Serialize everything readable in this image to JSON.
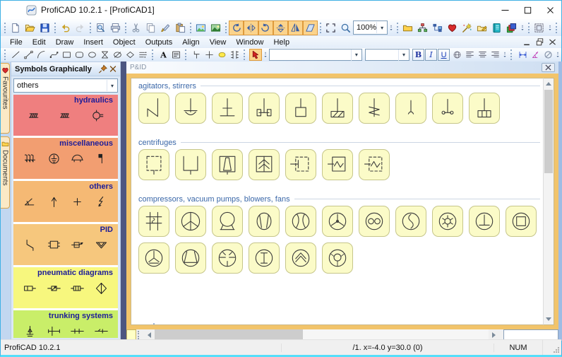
{
  "window": {
    "title": "ProfiCAD 10.2.1 - [ProfiCAD1]"
  },
  "menu": {
    "items": [
      "File",
      "Edit",
      "Draw",
      "Insert",
      "Object",
      "Outputs",
      "Align",
      "View",
      "Window",
      "Help"
    ]
  },
  "toolbar1": {
    "zoom_value": "100%",
    "file": [
      {
        "name": "new-button",
        "icon": "new"
      },
      {
        "name": "open-button",
        "icon": "open"
      },
      {
        "name": "save-button",
        "icon": "save"
      }
    ],
    "undo": [
      {
        "name": "undo-button",
        "icon": "undo"
      },
      {
        "name": "redo-button",
        "icon": "redo",
        "cls": "dis"
      }
    ],
    "print": [
      {
        "name": "print-preview-button",
        "icon": "preview"
      },
      {
        "name": "print-button",
        "icon": "print"
      }
    ],
    "clipboard": [
      {
        "name": "cut-button",
        "icon": "cut"
      },
      {
        "name": "copy-button",
        "icon": "copy"
      },
      {
        "name": "format-painter-button",
        "icon": "paint"
      },
      {
        "name": "paste-button",
        "icon": "paste"
      }
    ],
    "images": [
      {
        "name": "export-image-button",
        "icon": "image"
      },
      {
        "name": "insert-image-button",
        "icon": "image2"
      }
    ],
    "transform": [
      {
        "name": "rotate-left-button",
        "icon": "rot-l",
        "cls": "orange"
      },
      {
        "name": "flip-horizontal-button",
        "icon": "flip-h",
        "cls": "orange"
      },
      {
        "name": "rotate-right-button",
        "icon": "rot-r",
        "cls": "orange"
      },
      {
        "name": "flip-vertical-button",
        "icon": "flip-v",
        "cls": "orange"
      },
      {
        "name": "mirror-button",
        "icon": "mirror",
        "cls": "orange"
      },
      {
        "name": "shear-button",
        "icon": "shear",
        "cls": "orange"
      }
    ],
    "view": [
      {
        "name": "select-region-button",
        "icon": "sel-region"
      },
      {
        "name": "zoom-button",
        "icon": "lens"
      }
    ],
    "panels": [
      {
        "name": "symbols-folder-button",
        "icon": "folder"
      },
      {
        "name": "hierarchy-button",
        "icon": "hierarchy"
      },
      {
        "name": "share-button",
        "icon": "share"
      },
      {
        "name": "favourites-button",
        "icon": "heart"
      },
      {
        "name": "magic-wand-button",
        "icon": "wand"
      },
      {
        "name": "edit-symbol-button",
        "icon": "sym-edit"
      },
      {
        "name": "notebook-button",
        "icon": "notebook"
      },
      {
        "name": "layers-button",
        "icon": "layers"
      }
    ],
    "grouping": [
      {
        "name": "group-objects-button",
        "icon": "group-objects"
      }
    ],
    "align": [
      {
        "name": "align-left-button",
        "icon": "al-left"
      },
      {
        "name": "align-center-button",
        "icon": "al-center"
      },
      {
        "name": "align-right-button",
        "icon": "al-right"
      },
      {
        "name": "align-top-button",
        "icon": "al-top"
      },
      {
        "name": "align-middle-button",
        "icon": "al-middle"
      },
      {
        "name": "align-bottom-button",
        "icon": "al-bottom"
      }
    ]
  },
  "toolbar2": {
    "draw": [
      {
        "name": "line-tool",
        "icon": "line"
      },
      {
        "name": "polyline-tool",
        "icon": "polyline"
      },
      {
        "name": "arc-tool",
        "icon": "arc"
      },
      {
        "name": "bezier-tool",
        "icon": "bezier"
      },
      {
        "name": "rectangle-tool",
        "icon": "rect"
      },
      {
        "name": "rounded-rectangle-tool",
        "icon": "round-rect"
      },
      {
        "name": "ellipse-tool",
        "icon": "ellipse"
      },
      {
        "name": "hourglass-tool",
        "icon": "hourglass"
      },
      {
        "name": "crossed-ellipse-tool",
        "icon": "ellipse-slash"
      },
      {
        "name": "label-tool",
        "icon": "diamond"
      },
      {
        "name": "line-style-tool",
        "icon": "line-style"
      }
    ],
    "text": [
      {
        "name": "text-tool",
        "icon": "text"
      },
      {
        "name": "textbox-tool",
        "icon": "textbox"
      }
    ],
    "place": [
      {
        "name": "gate-tool",
        "icon": "gate"
      },
      {
        "name": "junction-tool",
        "icon": "junction"
      },
      {
        "name": "node-tool",
        "icon": "node"
      },
      {
        "name": "ic-pins-tool",
        "icon": "ic-pins"
      }
    ],
    "pointer": [
      {
        "name": "pointer-tool",
        "icon": "pointer",
        "cls": "orange"
      }
    ],
    "font_family_value": "",
    "font_size_value": "",
    "format": [
      {
        "name": "bold-button",
        "label": "B",
        "cls": "fb"
      },
      {
        "name": "italic-button",
        "label": "I",
        "cls": "fi"
      },
      {
        "name": "underline-button",
        "label": "U",
        "cls": "fu"
      }
    ],
    "link": [
      {
        "name": "hyperlink-button",
        "icon": "globe"
      }
    ],
    "text_align": [
      {
        "name": "text-align-left-button",
        "icon": "txt-left"
      },
      {
        "name": "text-align-center-button",
        "icon": "txt-center"
      },
      {
        "name": "text-align-right-button",
        "icon": "txt-right"
      }
    ],
    "dimension": [
      {
        "name": "linear-dimension-button",
        "icon": "dim-linear"
      },
      {
        "name": "angle-dimension-button",
        "icon": "dim-angle"
      },
      {
        "name": "no-dimension-button",
        "icon": "dim-off"
      }
    ]
  },
  "sidebar": {
    "header": "Symbols Graphically",
    "dropdown_value": "others",
    "tabs": [
      {
        "label": "Favourites",
        "icon": "heart"
      },
      {
        "label": "Documents",
        "icon": "folder"
      }
    ],
    "sections": [
      {
        "title": "hydraulics",
        "color": "#ef7f7f",
        "symbols": [
          "hy-hatch",
          "hy-hatch",
          "hy-gauge"
        ]
      },
      {
        "title": "miscellaneous",
        "color": "#f29e71",
        "symbols": [
          "mi-pins",
          "mi-earth",
          "mi-dome",
          "mi-flag"
        ]
      },
      {
        "title": "others",
        "color": "#f5b974",
        "symbols": [
          "ot-angle",
          "ot-arrow",
          "ot-plus",
          "ot-bolt"
        ]
      },
      {
        "title": "PID",
        "color": "#f6c77d",
        "symbols": [
          "pd-slope",
          "pd-vessel",
          "pd-valve",
          "pd-funnel"
        ]
      },
      {
        "title": "pneumatic diagrams",
        "color": "#f7f77e",
        "symbols": [
          "pn-cyl",
          "pn-valve",
          "pn-box",
          "pn-filter"
        ]
      },
      {
        "title": "trunking systems",
        "color": "#c9ee69",
        "symbols": [
          "tr-pole",
          "tr-tee",
          "tr-ticks",
          "tr-tick"
        ]
      }
    ]
  },
  "document": {
    "title": "P&ID",
    "tile_color": "#fbfbc8",
    "groups": [
      {
        "title": "agitators, stirrers",
        "tiles": [
          "ag-zigzag",
          "ag-anchor",
          "ag-cross",
          "ag-paddle",
          "ag-frame",
          "ag-hatched",
          "ag-helical",
          "ag-hook",
          "ag-propeller",
          "ag-turbine"
        ]
      },
      {
        "title": "centrifuges",
        "tiles": [
          "cf-dashed",
          "cf-open",
          "cf-conical",
          "cf-chevron",
          "cf-inlet",
          "cf-wave",
          "cf-wave-d"
        ]
      },
      {
        "title": "compressors, vacuum pumps, blowers, fans",
        "tiles": [
          "cp-piston",
          "cp-fan",
          "cp-pump",
          "cp-venturi",
          "cp-lobes",
          "cp-propeller",
          "cp-twin",
          "cp-srotor",
          "cp-gear",
          "cp-tee",
          "cp-square",
          "cq-fanline",
          "cq-bucket",
          "cq-segments",
          "cq-ibeam",
          "cq-chevron",
          "cq-ring"
        ]
      },
      {
        "title": "crushers",
        "tiles": []
      }
    ]
  },
  "statusbar": {
    "app": "ProfiCAD 10.2.1",
    "coords": "/1.  x=-4.0  y=30.0 (0)",
    "num": "NUM"
  }
}
